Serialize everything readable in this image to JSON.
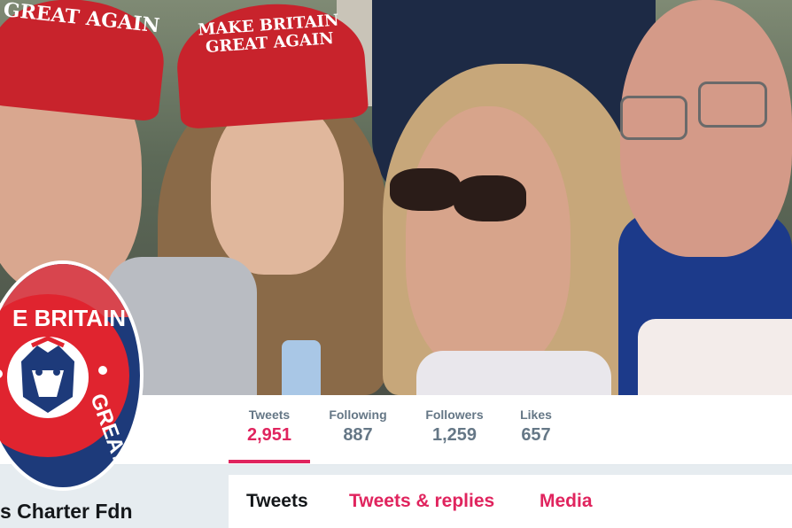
{
  "banner": {
    "cap1_text": "GREAT AGAIN",
    "cap2_line1": "MAKE BRITAIN",
    "cap2_line2": "GREAT AGAIN"
  },
  "profile": {
    "avatar_text_top": "E BRITAIN",
    "avatar_text_side": "GREAT A",
    "name": "s Charter Fdn"
  },
  "stats": [
    {
      "label": "Tweets",
      "value": "2,951"
    },
    {
      "label": "Following",
      "value": "887"
    },
    {
      "label": "Followers",
      "value": "1,259"
    },
    {
      "label": "Likes",
      "value": "657"
    }
  ],
  "tabs": [
    {
      "label": "Tweets"
    },
    {
      "label": "Tweets & replies"
    },
    {
      "label": "Media"
    }
  ],
  "colors": {
    "accent": "#e0245e",
    "stat_gray": "#657786",
    "cap_red": "#c8232c",
    "logo_navy": "#1d3a7a"
  }
}
